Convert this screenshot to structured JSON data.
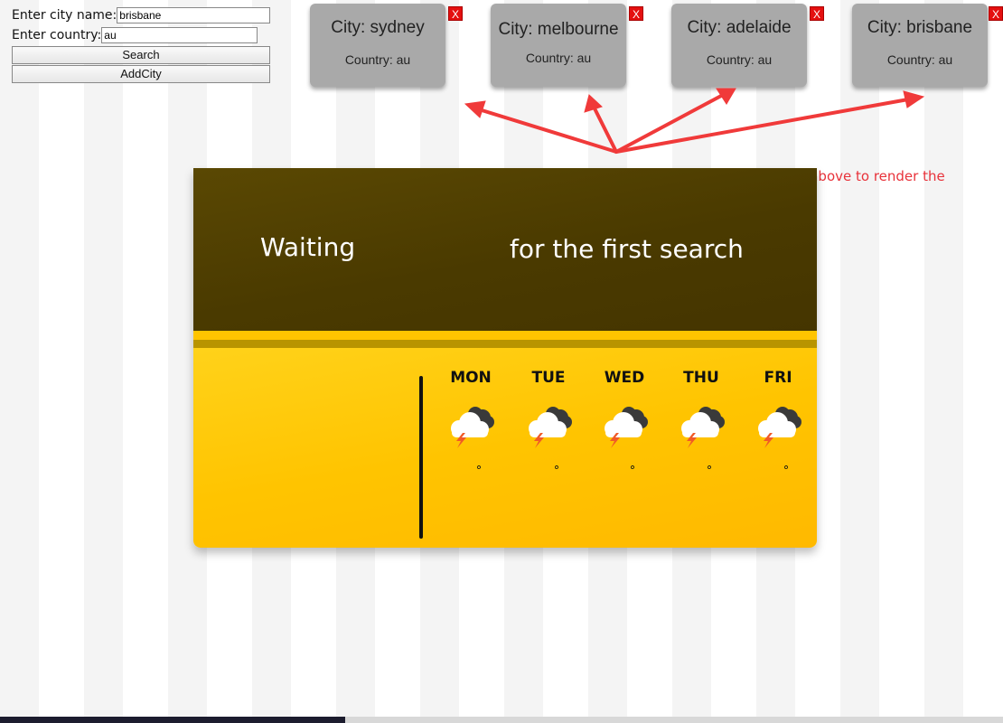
{
  "form": {
    "city_label": "Enter city name:",
    "city_value": "brisbane",
    "country_label": "Enter country:",
    "country_value": "au",
    "search_label": "Search",
    "addcity_label": "AddCity"
  },
  "cards": [
    {
      "city": "City: sydney",
      "country": "Country: au",
      "close": "X"
    },
    {
      "city": "City: melbourne",
      "country": "Country: au",
      "close": "X"
    },
    {
      "city": "City: adelaide",
      "country": "Country: au",
      "close": "X"
    },
    {
      "city": "City: brisbane",
      "country": "Country: au",
      "close": "X"
    }
  ],
  "hint": "click any city from above to render the Weather App",
  "weather": {
    "title": "Waiting",
    "subtitle": "for the first search",
    "days": [
      {
        "name": "MON",
        "temp": "°",
        "icon": "thunderstorm-icon"
      },
      {
        "name": "TUE",
        "temp": "°",
        "icon": "thunderstorm-icon"
      },
      {
        "name": "WED",
        "temp": "°",
        "icon": "thunderstorm-icon"
      },
      {
        "name": "THU",
        "temp": "°",
        "icon": "thunderstorm-icon"
      },
      {
        "name": "FRI",
        "temp": "°",
        "icon": "thunderstorm-icon"
      }
    ]
  },
  "colors": {
    "card_bg": "#a9a9a9",
    "close_red": "#e41010",
    "hint_red": "#e8323a",
    "arrow_red": "#f03a3a",
    "weather_top": "#4a3a00",
    "weather_bottom": "#ffc400"
  }
}
